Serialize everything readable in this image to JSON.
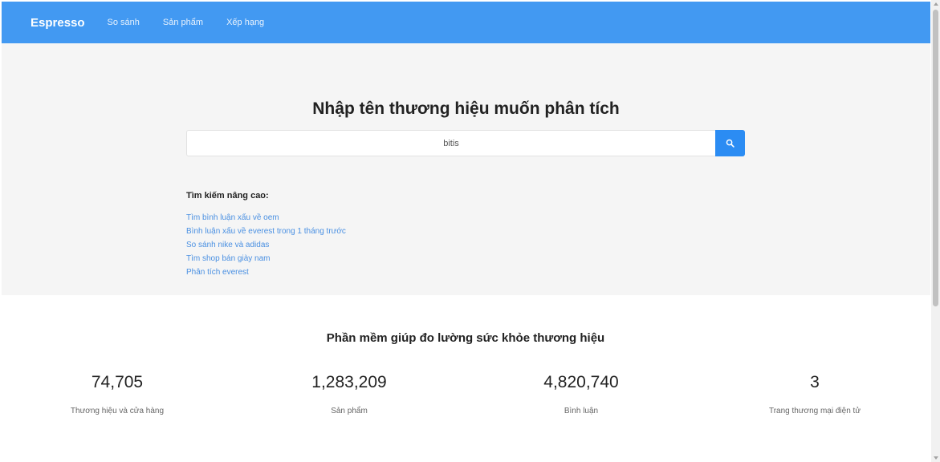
{
  "navbar": {
    "brand": "Espresso",
    "links": [
      "So sánh",
      "Sản phẩm",
      "Xếp hạng"
    ]
  },
  "hero": {
    "title": "Nhập tên thương hiệu muốn phân tích",
    "search": {
      "value": "bitis",
      "button_icon": "search-icon"
    },
    "advanced": {
      "title": "Tìm kiếm nâng cao:",
      "links": [
        "Tìm bình luận xấu về oem",
        "Bình luận xấu về everest trong 1 tháng trước",
        "So sánh nike và adidas",
        "Tìm shop bán giày nam",
        "Phân tích everest"
      ]
    }
  },
  "stats": {
    "title": "Phần mềm giúp đo lường sức khỏe thương hiệu",
    "items": [
      {
        "value": "74,705",
        "label": "Thương hiệu và cửa hàng"
      },
      {
        "value": "1,283,209",
        "label": "Sản phẩm"
      },
      {
        "value": "4,820,740",
        "label": "Bình luận"
      },
      {
        "value": "3",
        "label": "Trang thương mại điện tử"
      }
    ]
  },
  "colors": {
    "navbar": "#4299f2",
    "search_button": "#2b8cf3",
    "link": "#4a90e2",
    "hero_background": "#f5f5f5"
  }
}
